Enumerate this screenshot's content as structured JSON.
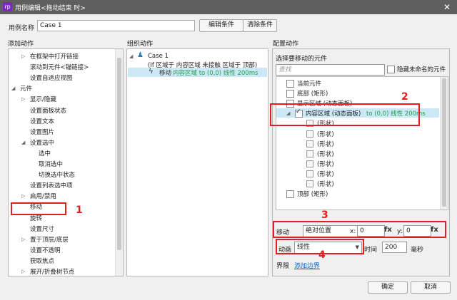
{
  "window": {
    "title": "用例编辑<拖动结束 时>",
    "close_glyph": "✕",
    "logo": "rp"
  },
  "case_name": {
    "label": "用例名称",
    "value": "Case 1"
  },
  "buttons": {
    "edit_condition": "编辑条件",
    "clear_condition": "清除条件",
    "ok": "确定",
    "cancel": "取消"
  },
  "sections": {
    "add_action": "添加动作",
    "organize_action": "组织动作",
    "configure_action": "配置动作"
  },
  "add_actions": [
    {
      "label": "在框架中打开链接",
      "indent": 2,
      "arrow": "▷"
    },
    {
      "label": "滚动到元件<锚链接>",
      "indent": 2,
      "arrow": ""
    },
    {
      "label": "设置自适应视图",
      "indent": 2,
      "arrow": ""
    },
    {
      "label": "元件",
      "indent": 1,
      "arrow": "◢"
    },
    {
      "label": "显示/隐藏",
      "indent": 2,
      "arrow": "▷"
    },
    {
      "label": "设置面板状态",
      "indent": 2,
      "arrow": ""
    },
    {
      "label": "设置文本",
      "indent": 2,
      "arrow": ""
    },
    {
      "label": "设置图片",
      "indent": 2,
      "arrow": ""
    },
    {
      "label": "设置选中",
      "indent": 2,
      "arrow": "◢"
    },
    {
      "label": "选中",
      "indent": 3,
      "arrow": ""
    },
    {
      "label": "取消选中",
      "indent": 3,
      "arrow": ""
    },
    {
      "label": "切换选中状态",
      "indent": 3,
      "arrow": ""
    },
    {
      "label": "设置列表选中项",
      "indent": 2,
      "arrow": ""
    },
    {
      "label": "启用/禁用",
      "indent": 2,
      "arrow": "▷"
    },
    {
      "label": "移动",
      "indent": 2,
      "arrow": ""
    },
    {
      "label": "旋转",
      "indent": 2,
      "arrow": ""
    },
    {
      "label": "设置尺寸",
      "indent": 2,
      "arrow": ""
    },
    {
      "label": "置于顶层/底层",
      "indent": 2,
      "arrow": "▷"
    },
    {
      "label": "设置不透明",
      "indent": 2,
      "arrow": ""
    },
    {
      "label": "获取焦点",
      "indent": 2,
      "arrow": ""
    },
    {
      "label": "展开/折叠树节点",
      "indent": 2,
      "arrow": "▷"
    }
  ],
  "organize": {
    "case_label": "Case 1",
    "condition": "(If 区域于 内容区域 未接触 区域于 顶部)",
    "action_prefix": "移动",
    "action_detail": "内容区域 to (0,0) 线性 200ms"
  },
  "configure": {
    "select_label": "选择要移动的元件",
    "search_placeholder": "查找",
    "hide_unnamed": "隐藏未命名的元件",
    "widgets": [
      {
        "label": "当前元件",
        "indent": 0,
        "arrow": "",
        "checked": false,
        "style": "cb"
      },
      {
        "label": "底部 (矩形)",
        "indent": 0,
        "arrow": "",
        "checked": false,
        "style": "cb"
      },
      {
        "label": "显示区域 (动态面板)",
        "indent": 0,
        "arrow": "",
        "checked": false,
        "style": "cb"
      },
      {
        "label": "内容区域 (动态面板)",
        "suffix": "to (0,0) 线性 200ms",
        "indent": 1,
        "arrow": "◢",
        "checked": true,
        "style": "cb",
        "selected": true
      },
      {
        "label": "(形状)",
        "indent": 2,
        "arrow": "",
        "checked": false,
        "style": "shape"
      },
      {
        "label": "(形状)",
        "indent": 2,
        "arrow": "",
        "checked": false,
        "style": "shape"
      },
      {
        "label": "(形状)",
        "indent": 2,
        "arrow": "",
        "checked": false,
        "style": "shape"
      },
      {
        "label": "(形状)",
        "indent": 2,
        "arrow": "",
        "checked": false,
        "style": "shape"
      },
      {
        "label": "(形状)",
        "indent": 2,
        "arrow": "",
        "checked": false,
        "style": "shape"
      },
      {
        "label": "(形状)",
        "indent": 2,
        "arrow": "",
        "checked": false,
        "style": "shape"
      },
      {
        "label": "(形状)",
        "indent": 2,
        "arrow": "",
        "checked": false,
        "style": "shape"
      },
      {
        "label": "顶部 (矩形)",
        "indent": 0,
        "arrow": "",
        "checked": false,
        "style": "cb"
      }
    ],
    "move": {
      "label": "移动",
      "mode": "绝对位置",
      "x_label": "x:",
      "x_value": "0",
      "y_label": "y:",
      "y_value": "0",
      "fx": "fx"
    },
    "animate": {
      "label": "动画",
      "easing": "线性",
      "time_label": "时间",
      "time_value": "200",
      "unit": "毫秒"
    },
    "bounds": {
      "label": "界限",
      "link": "添加边界"
    }
  },
  "annotations": {
    "n1": "1",
    "n2": "2",
    "n3": "3",
    "n4": "4"
  },
  "colors": {
    "accent_red": "#e02020",
    "link_blue": "#0a66c2",
    "action_green": "#1e9e4a",
    "selected_row": "#cce8f6"
  }
}
